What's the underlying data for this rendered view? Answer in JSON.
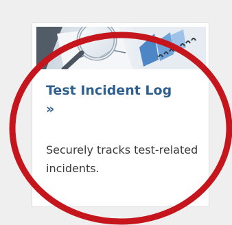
{
  "card": {
    "title": "Test Incident Log »",
    "description": "Securely tracks test-related incidents.",
    "thumbnail_icon": "magnifying-glass-over-charts"
  },
  "annotation": {
    "shape": "circle-highlight",
    "color": "#c4161c"
  },
  "colors": {
    "title": "#2f5f8f",
    "text": "#3a3a3a",
    "background": "#efefef",
    "card": "#ffffff"
  }
}
